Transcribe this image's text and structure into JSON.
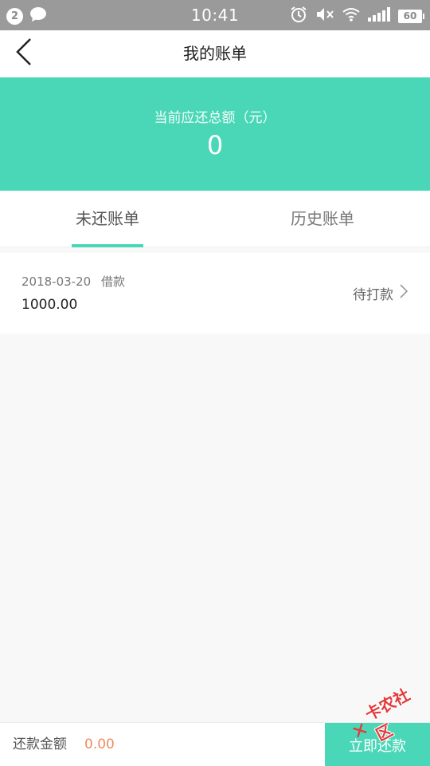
{
  "status_bar": {
    "notification_count": "2",
    "time": "10:41",
    "battery": "60",
    "icons": [
      "chat-bubble-icon",
      "alarm-icon",
      "mute-icon",
      "wifi-icon",
      "signal-icon",
      "battery-icon"
    ]
  },
  "header": {
    "title": "我的账单",
    "back_icon": "chevron-left-icon"
  },
  "summary": {
    "label": "当前应还总额（元）",
    "value": "0"
  },
  "tabs": [
    {
      "label": "未还账单",
      "active": true
    },
    {
      "label": "历史账单",
      "active": false
    }
  ],
  "bills": [
    {
      "date": "2018-03-20",
      "type": "借款",
      "amount": "1000.00",
      "status": "待打款",
      "status_icon": "chevron-right-icon"
    }
  ],
  "bottom_bar": {
    "label": "还款金额",
    "amount": "0.00",
    "button_label": "立即还款"
  },
  "watermark": {
    "text": "卡农社区"
  },
  "colors": {
    "accent": "#4ad7b7",
    "amount_orange": "#f08a5d",
    "status_bar": "#9a9a9a"
  }
}
